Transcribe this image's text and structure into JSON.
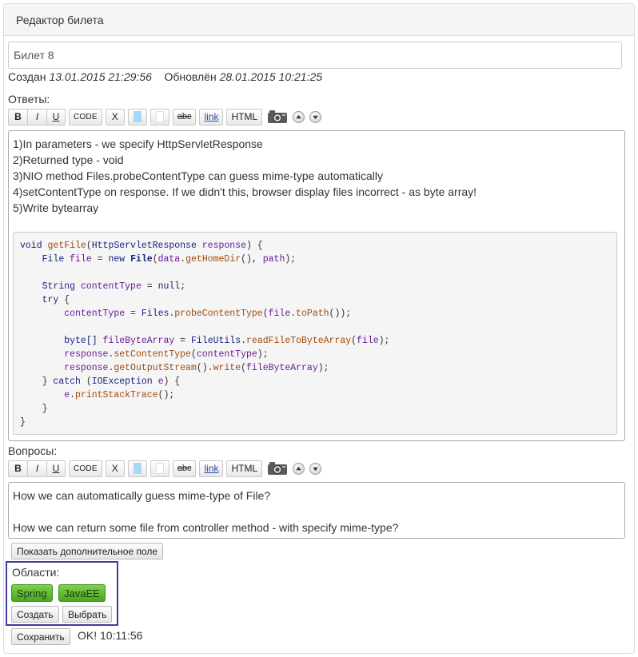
{
  "panel": {
    "heading": "Редактор билета"
  },
  "ticket": {
    "title": "Билет 8",
    "created_label": "Создан",
    "created_value": "13.01.2015 21:29:56",
    "updated_label": "Обновлён",
    "updated_value": "28.01.2015 10:21:25"
  },
  "toolbar": {
    "bold": "B",
    "italic": "I",
    "underline": "U",
    "code": "CODE",
    "clear": "X",
    "strike": "abc",
    "link": "link",
    "html": "HTML"
  },
  "answers": {
    "label": "Ответы:",
    "lines": [
      "1)In parameters - we specify HttpServletResponse",
      "2)Returned type - void",
      "3)NIO method Files.probeContentType can guess mime-type automatically",
      "4)setContentType on response. If we didn't this, browser display files incorrect - as byte array!",
      "5)Write bytearray"
    ],
    "code": {
      "kw_void": "void",
      "fn_getFile": "getFile",
      "ty_HttpServletResponse": "HttpServletResponse",
      "vr_response": "response",
      "ty_File": "File",
      "vr_file": "file",
      "kw_new": "new",
      "ty_File2": "File",
      "vr_data": "data",
      "fn_getHomeDir": "getHomeDir",
      "vr_path": "path",
      "ty_String": "String",
      "vr_contentType": "contentType",
      "kw_null": "null",
      "kw_try": "try",
      "vr_contentType2": "contentType",
      "ty_Files": "Files",
      "fn_probeContentType": "probeContentType",
      "vr_file2": "file",
      "fn_toPath": "toPath",
      "ty_byte": "byte[]",
      "vr_fileByteArray": "fileByteArray",
      "ty_FileUtils": "FileUtils",
      "fn_readFileToByteArray": "readFileToByteArray",
      "vr_file3": "file",
      "vr_response2": "response",
      "fn_setContentType": "setContentType",
      "vr_contentType3": "contentType",
      "vr_response3": "response",
      "fn_getOutputStream": "getOutputStream",
      "fn_write": "write",
      "vr_fileByteArray2": "fileByteArray",
      "kw_catch": "catch",
      "ty_IOException": "IOException",
      "vr_e": "e",
      "vr_e2": "e",
      "fn_printStackTrace": "printStackTrace"
    }
  },
  "questions": {
    "label": "Вопросы:",
    "lines": [
      "How we can automatically guess mime-type of File?",
      "How we can return some file from controller method - with specify mime-type?"
    ]
  },
  "show_extra_button": "Показать дополнительное поле",
  "areas": {
    "label": "Области:",
    "tags": [
      "Spring",
      "JavaEE"
    ],
    "create_button": "Создать",
    "choose_button": "Выбрать"
  },
  "save_button": "Сохранить",
  "status": "OK! 10:11:56",
  "colors": {
    "tag_green": "#5cb82e",
    "highlight_border": "#3d3d9e"
  }
}
